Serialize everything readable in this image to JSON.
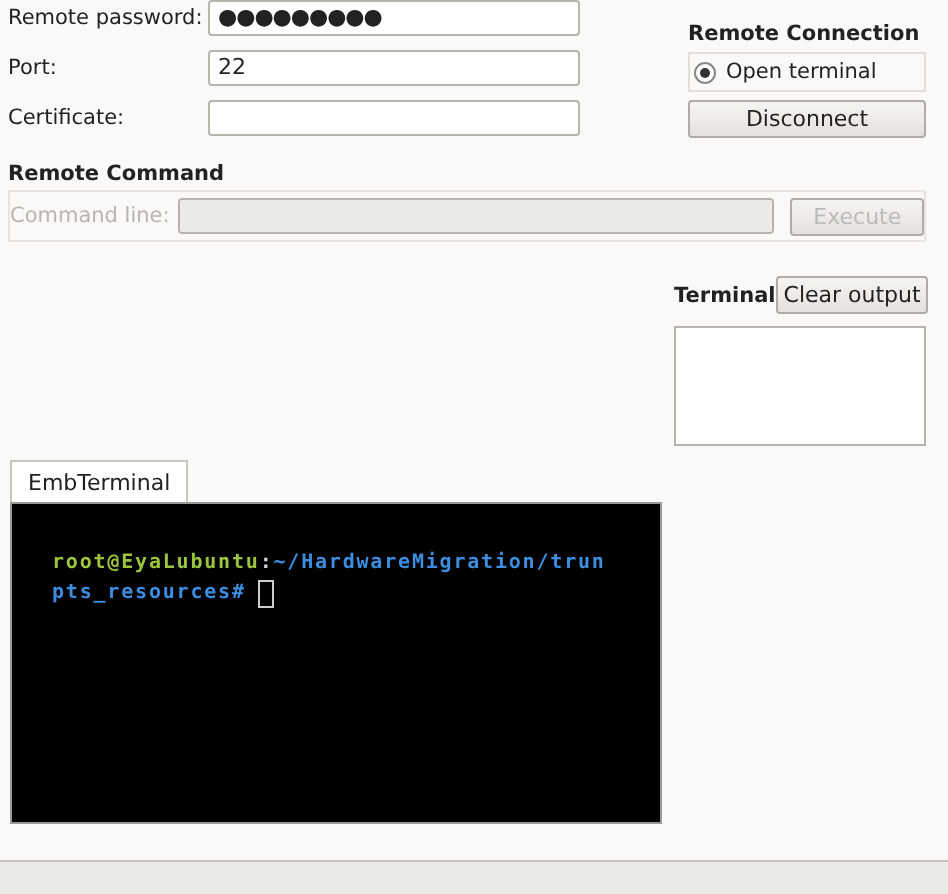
{
  "connection_fields": [
    {
      "label": "Remote password:",
      "value": "●●●●●●●●●",
      "kind": "password"
    },
    {
      "label": "Port:",
      "value": "22",
      "kind": "text"
    },
    {
      "label": "Certificate:",
      "kind": "text"
    }
  ],
  "remote_connection": {
    "title": "Remote Connection",
    "radio": {
      "label": "Open terminal",
      "selected": true
    },
    "button": "Disconnect"
  },
  "remote_command": {
    "title": "Remote Command",
    "label": "Command line:",
    "disabled": true,
    "button": "Execute",
    "button_disabled": true
  },
  "terminal_panel": {
    "label": "Terminal",
    "button": "Clear output"
  },
  "tabs": [
    {
      "label": "EmbTerminal",
      "selected": true
    }
  ],
  "embedded_terminal": {
    "lines": [
      [
        {
          "text": "root@EyaLubuntu",
          "color": "#9bc53d"
        },
        {
          "text": ":",
          "color": "#d0d0d0"
        },
        {
          "text": "~/HardwareMigration/trun",
          "color": "#3b8ee0"
        }
      ],
      [
        {
          "text": "pts_resources#",
          "color": "#3b8ee0"
        }
      ]
    ],
    "cursor": true
  }
}
